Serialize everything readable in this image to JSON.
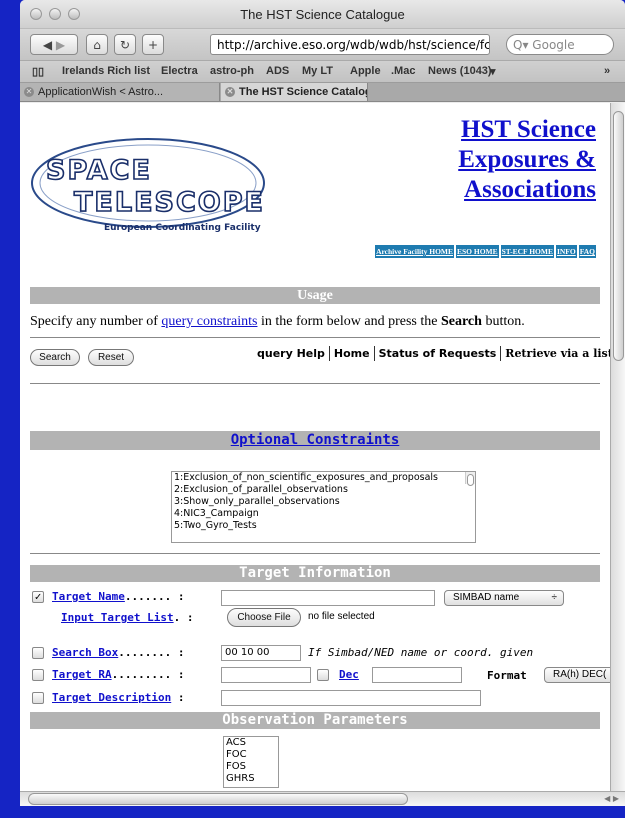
{
  "browser": {
    "title": "The HST Science Catalogue",
    "url": "http://archive.eso.org/wdb/wdb/hst/science/fc",
    "search_placeholder": "Google",
    "bookmarks": [
      "Irelands Rich list",
      "Electra",
      "astro-ph",
      "ADS",
      "My LT",
      "Apple",
      ".Mac",
      "News (1043)"
    ],
    "tabs": [
      "ApplicationWish < Astro...",
      "The HST Science Catalog..."
    ]
  },
  "header": {
    "logo_line1": "SPACE",
    "logo_line2": "TELESCOPE",
    "logo_sub": "European Coordinating Facility",
    "title_lines": [
      "HST Science",
      "Exposures &",
      "Associations"
    ],
    "nav": [
      "Archive Facility HOME",
      "ESO HOME",
      "ST-ECF HOME",
      "INFO",
      "FAQ"
    ]
  },
  "usage": {
    "heading": "Usage",
    "text_before": "Specify any number of ",
    "link": "query constraints",
    "text_mid": " in the form below and press the ",
    "bold": "Search",
    "text_after": " button."
  },
  "actions": {
    "search": "Search",
    "reset": "Reset",
    "links": [
      "query Help",
      "Home",
      "Status of Requests",
      "Retrieve via a list"
    ]
  },
  "optional": {
    "heading": "Optional Constraints",
    "items": [
      "1:Exclusion_of_non_scientific_exposures_and_proposals",
      "2:Exclusion_of_parallel_observations",
      "3:Show_only_parallel_observations",
      "4:NIC3_Campaign",
      "5:Two_Gyro_Tests"
    ]
  },
  "target": {
    "heading": "Target Information",
    "name_label": "Target Name",
    "name_dots": "....... :",
    "name_checked": true,
    "name_resolver": "SIMBAD name",
    "list_label": "Input Target List",
    "list_dots": ". :",
    "choose_file": "Choose File",
    "no_file": "no file selected",
    "box_label": "Search Box",
    "box_dots": "........ :",
    "box_value": "00 10 00",
    "box_hint": "If Simbad/NED name or coord. given",
    "ra_label": "Target RA",
    "ra_dots": "......... :",
    "dec_label": "Dec",
    "format_label": "Format",
    "format_value": "RA(h) DEC(",
    "desc_label": "Target Description",
    "desc_dots": ":"
  },
  "observation": {
    "heading": "Observation Parameters",
    "instruments": [
      "ACS",
      "FOC",
      "FOS",
      "GHRS"
    ]
  }
}
